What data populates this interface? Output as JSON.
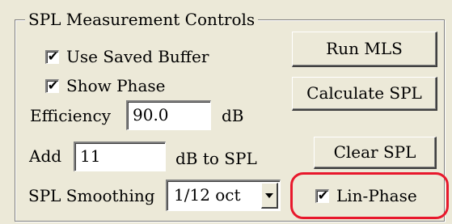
{
  "group": {
    "title": "SPL Measurement Controls"
  },
  "checkboxes": {
    "use_saved_buffer": {
      "label": "Use Saved Buffer",
      "checked": true
    },
    "show_phase": {
      "label": "Show Phase",
      "checked": true
    },
    "lin_phase": {
      "label": "Lin-Phase",
      "checked": true
    }
  },
  "efficiency": {
    "label": "Efficiency",
    "value": "90.0",
    "unit": "dB"
  },
  "add": {
    "label": "Add",
    "value": "11",
    "unit": "dB to SPL"
  },
  "smoothing": {
    "label": "SPL Smoothing",
    "selected": "1/12 oct"
  },
  "buttons": {
    "run_mls": "Run MLS",
    "calculate_spl": "Calculate SPL",
    "clear_spl": "Clear SPL"
  },
  "icons": {
    "check": "✔",
    "dropdown": "chevron-down-icon"
  },
  "colors": {
    "panel_bg": "#ece9d8",
    "highlight": "#e8182c"
  }
}
